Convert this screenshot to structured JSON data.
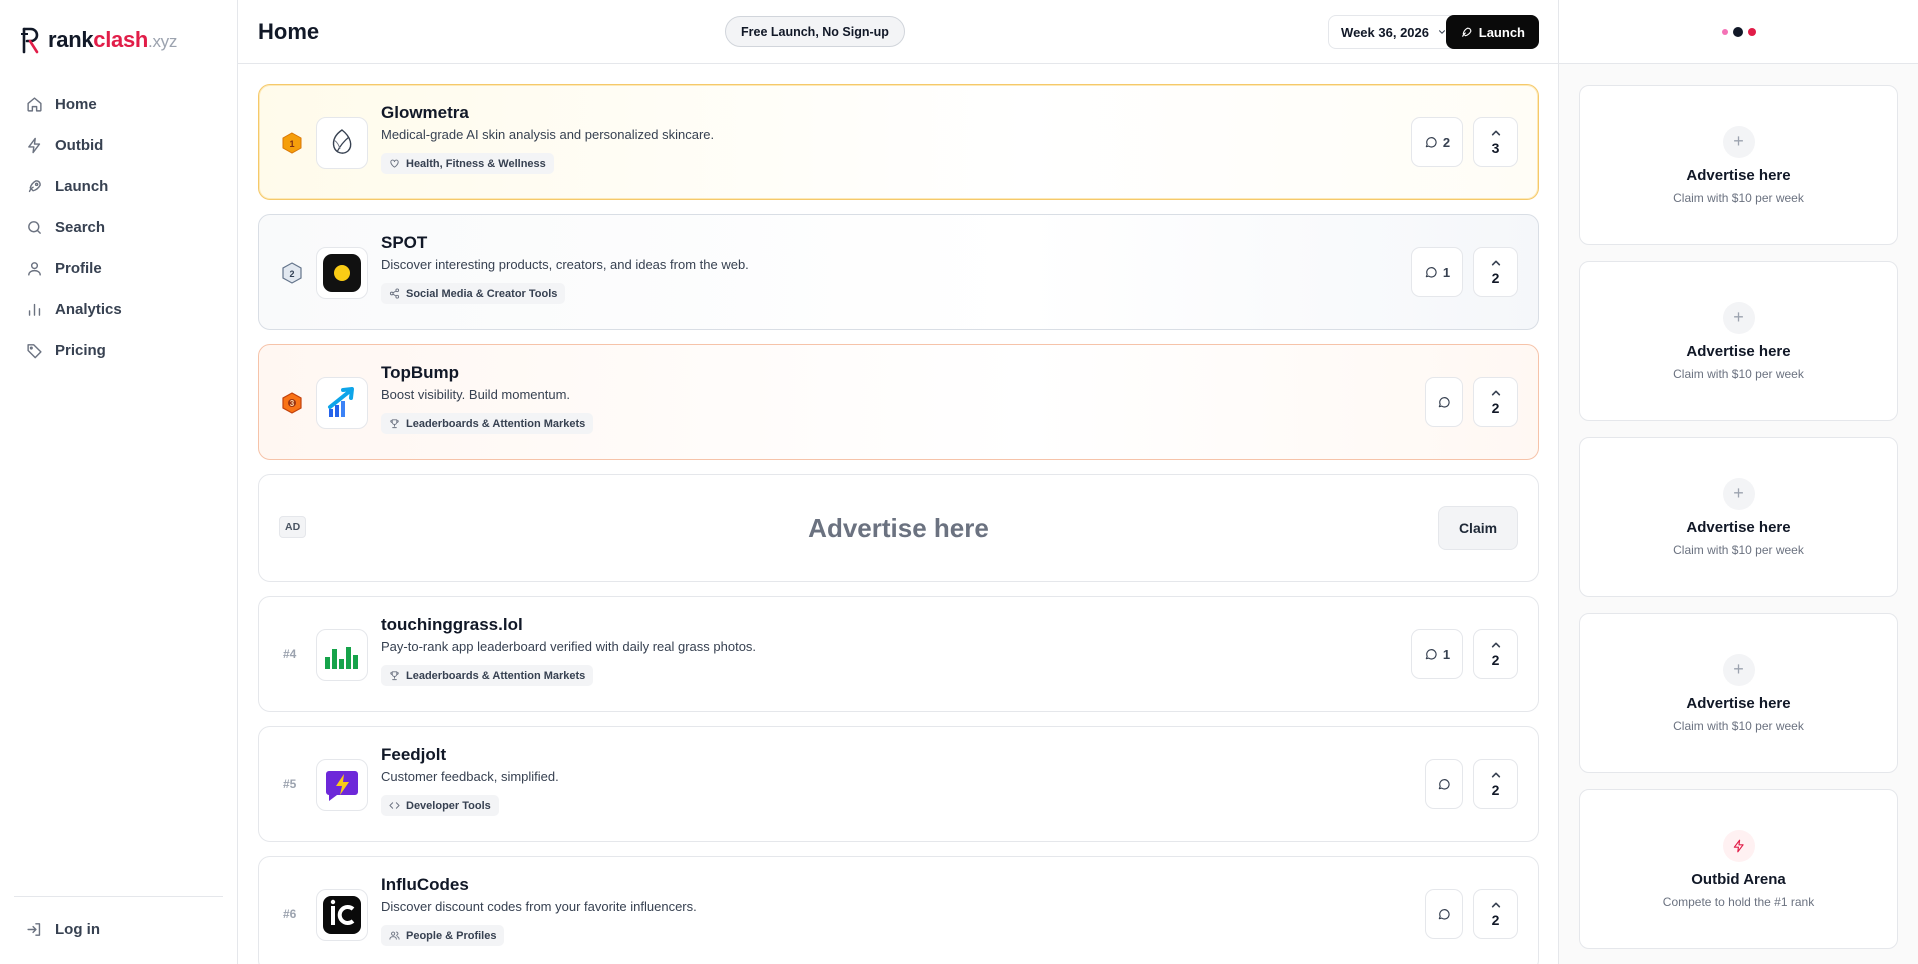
{
  "brand": {
    "rank": "rank",
    "clash": "clash",
    "tld": ".xyz"
  },
  "nav": [
    {
      "label": "Home",
      "icon": "home-icon"
    },
    {
      "label": "Outbid",
      "icon": "zap-icon"
    },
    {
      "label": "Launch",
      "icon": "rocket-icon"
    },
    {
      "label": "Search",
      "icon": "search-icon"
    },
    {
      "label": "Profile",
      "icon": "user-icon"
    },
    {
      "label": "Analytics",
      "icon": "bar-chart-icon"
    },
    {
      "label": "Pricing",
      "icon": "tag-icon"
    }
  ],
  "login_label": "Log in",
  "header": {
    "title": "Home",
    "pill": "Free Launch, No Sign-up",
    "week": "Week 36, 2026",
    "launch": "Launch"
  },
  "products": [
    {
      "rank": "1",
      "name": "Glowmetra",
      "desc": "Medical-grade AI skin analysis and personalized skincare.",
      "tag": "Health, Fitness & Wellness",
      "comments": "2",
      "votes": "3"
    },
    {
      "rank": "2",
      "name": "SPOT",
      "desc": "Discover interesting products, creators, and ideas from the web.",
      "tag": "Social Media & Creator Tools",
      "comments": "1",
      "votes": "2"
    },
    {
      "rank": "3",
      "name": "TopBump",
      "desc": "Boost visibility. Build momentum.",
      "tag": "Leaderboards & Attention Markets",
      "comments": "",
      "votes": "2"
    }
  ],
  "ad": {
    "badge": "AD",
    "title": "Advertise here",
    "claim": "Claim"
  },
  "products_more": [
    {
      "rank": "#4",
      "name": "touchinggrass.lol",
      "desc": "Pay-to-rank app leaderboard verified with daily real grass photos.",
      "tag": "Leaderboards & Attention Markets",
      "comments": "1",
      "votes": "2"
    },
    {
      "rank": "#5",
      "name": "Feedjolt",
      "desc": "Customer feedback, simplified.",
      "tag": "Developer Tools",
      "comments": "",
      "votes": "2"
    },
    {
      "rank": "#6",
      "name": "InfluCodes",
      "desc": "Discover discount codes from your favorite influencers.",
      "tag": "People & Profiles",
      "comments": "",
      "votes": "2"
    }
  ],
  "ad_slots": [
    {
      "icon": "+",
      "title": "Advertise here",
      "sub": "Claim with $10 per week"
    },
    {
      "icon": "+",
      "title": "Advertise here",
      "sub": "Claim with $10 per week"
    },
    {
      "icon": "+",
      "title": "Advertise here",
      "sub": "Claim with $10 per week"
    },
    {
      "icon": "+",
      "title": "Advertise here",
      "sub": "Claim with $10 per week"
    }
  ],
  "arena": {
    "title": "Outbid Arena",
    "sub": "Compete to hold the #1 rank"
  },
  "colors": {
    "accent": "#e11d48",
    "gold": "#f59e0b",
    "silver": "#64748b",
    "bronze": "#ea580c"
  }
}
